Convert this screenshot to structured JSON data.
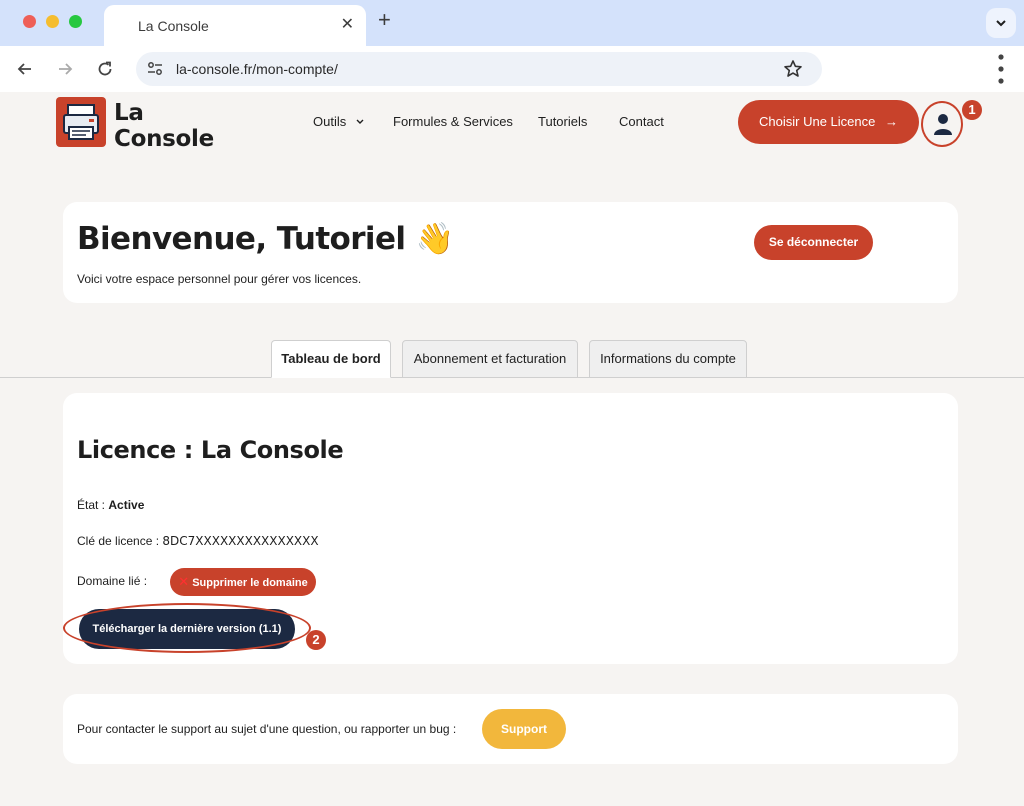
{
  "browser": {
    "tab_title": "La Console",
    "tab_close": "✕",
    "new_tab": "+",
    "url": "la-console.fr/mon-compte/"
  },
  "site": {
    "logo_line1": "La",
    "logo_line2": "Console",
    "nav": {
      "outils": "Outils",
      "formules": "Formules & Services",
      "tutoriels": "Tutoriels",
      "contact": "Contact"
    },
    "cta_label": "Choisir Une Licence",
    "cta_arrow": "→",
    "badge_1": "1",
    "badge_2": "2"
  },
  "welcome": {
    "title": "Bienvenue, Tutoriel 👋",
    "subtitle": "Voici votre espace personnel pour gérer vos licences.",
    "logout_label": "Se déconnecter"
  },
  "tabs": [
    {
      "label": "Tableau de bord"
    },
    {
      "label": "Abonnement et facturation"
    },
    {
      "label": "Informations du compte"
    }
  ],
  "licence": {
    "title": "Licence : La Console",
    "state_label": "État : ",
    "state_value": "Active",
    "key_label": "Clé de licence : ",
    "key_value": "8DC7XXXXXXXXXXXXXXX",
    "domain_label": "Domaine lié :",
    "delete_x": "✕",
    "delete_label": "Supprimer le domaine",
    "download_label": "Télécharger la dernière version (1.1)"
  },
  "support": {
    "text": "Pour contacter le support au sujet d'une question, ou rapporter un bug :",
    "button_label": "Support"
  },
  "colors": {
    "brand": "#c8422b",
    "navy": "#1c2942",
    "support": "#f2b73c"
  },
  "icons": [
    "search-icon",
    "back-arrow-icon",
    "forward-arrow-icon",
    "reload-icon",
    "site-info-icon",
    "star-icon",
    "kebab-menu-icon",
    "chevron-down-icon",
    "user-icon",
    "printer-logo-icon"
  ]
}
